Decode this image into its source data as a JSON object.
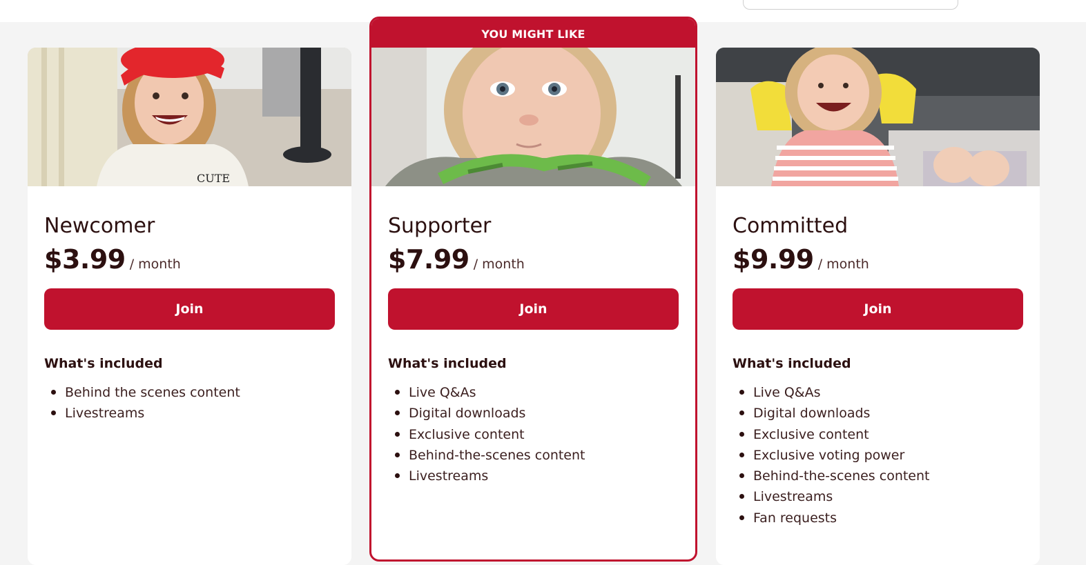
{
  "featured_label": "YOU MIGHT LIKE",
  "tiers": [
    {
      "name": "Newcomer",
      "price": "$3.99",
      "period": "/ month",
      "join_label": "Join",
      "included_title": "What's included",
      "features": [
        "Behind the scenes content",
        "Livestreams"
      ]
    },
    {
      "name": "Supporter",
      "price": "$7.99",
      "period": "/ month",
      "join_label": "Join",
      "included_title": "What's included",
      "features": [
        "Live Q&As",
        "Digital downloads",
        "Exclusive content",
        "Behind-the-scenes content",
        "Livestreams"
      ]
    },
    {
      "name": "Committed",
      "price": "$9.99",
      "period": "/ month",
      "join_label": "Join",
      "included_title": "What's included",
      "features": [
        "Live Q&As",
        "Digital downloads",
        "Exclusive content",
        "Exclusive voting power",
        "Behind-the-scenes content",
        "Livestreams",
        "Fan requests"
      ]
    }
  ],
  "colors": {
    "brand": "#c0122e",
    "text": "#2c1010",
    "background": "#f4f4f4"
  }
}
